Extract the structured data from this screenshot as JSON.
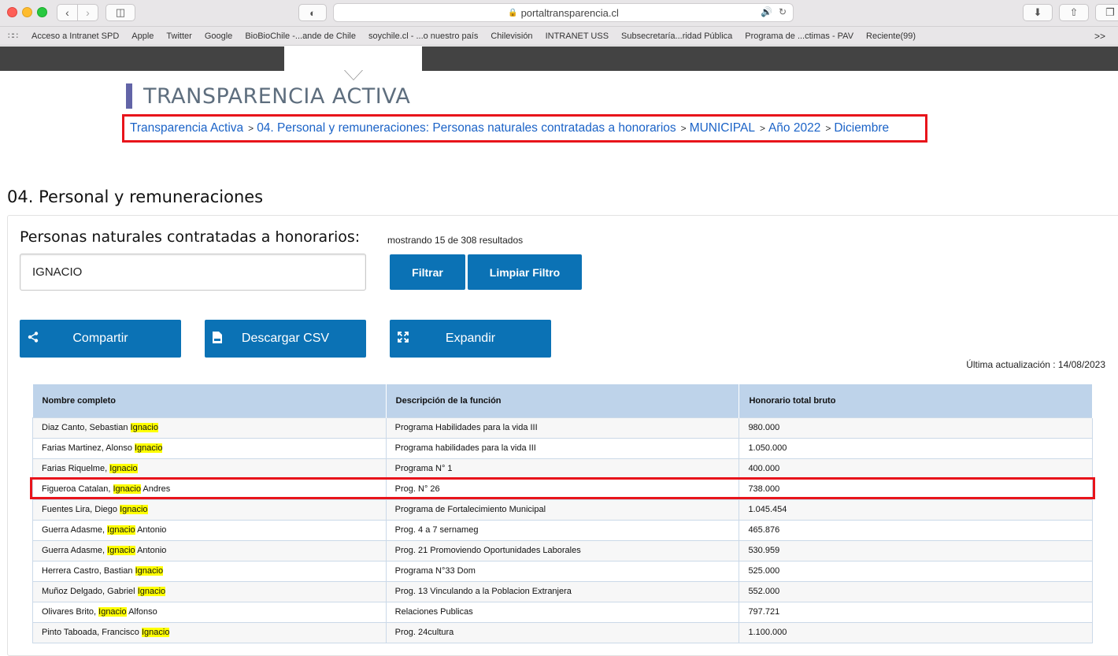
{
  "browser": {
    "url": "portaltransparencia.cl",
    "bookmarks": [
      "Acceso a Intranet SPD",
      "Apple",
      "Twitter",
      "Google",
      "BioBioChile -...ande de Chile",
      "soychile.cl - ...o nuestro país",
      "Chilevisión",
      "INTRANET USS",
      "Subsecretaría...ridad Pública",
      "Programa de ...ctimas - PAV",
      "Reciente(99)"
    ],
    "more": ">>"
  },
  "header": {
    "title": "TRANSPARENCIA ACTIVA",
    "breadcrumb": [
      "Transparencia Activa",
      "04. Personal y remuneraciones: Personas naturales contratadas a honorarios",
      "MUNICIPAL",
      "Año 2022",
      "Diciembre"
    ],
    "separator": ">"
  },
  "section": {
    "title": "04. Personal y remuneraciones"
  },
  "card": {
    "title": "Personas naturales contratadas a honorarios:",
    "results_count": "mostrando 15 de 308 resultados",
    "search_value": "IGNACIO",
    "filter_button": "Filtrar",
    "clear_button": "Limpiar Filtro",
    "share_button": "Compartir",
    "csv_button": "Descargar CSV",
    "expand_button": "Expandir",
    "last_updated": "Última actualización : 14/08/2023"
  },
  "table": {
    "columns": [
      "Nombre completo",
      "Descripción de la función",
      "Honorario total bruto"
    ],
    "highlight_term": "Ignacio",
    "rows": [
      {
        "pre": "Diaz Canto, Sebastian ",
        "match": "Ignacio",
        "post": "",
        "funcion": "Programa Habilidades para la vida III",
        "honorario": "980.000"
      },
      {
        "pre": "Farias Martinez, Alonso ",
        "match": "Ignacio",
        "post": "",
        "funcion": "Programa habilidades para la vida III",
        "honorario": "1.050.000"
      },
      {
        "pre": "Farias Riquelme, ",
        "match": "Ignacio",
        "post": "",
        "funcion": "Programa N° 1",
        "honorario": "400.000"
      },
      {
        "pre": "Figueroa Catalan, ",
        "match": "Ignacio",
        "post": " Andres",
        "funcion": "Prog. N° 26",
        "honorario": "738.000"
      },
      {
        "pre": "Fuentes Lira, Diego ",
        "match": "Ignacio",
        "post": "",
        "funcion": "Programa de Fortalecimiento Municipal",
        "honorario": "1.045.454"
      },
      {
        "pre": "Guerra Adasme, ",
        "match": "Ignacio",
        "post": " Antonio",
        "funcion": "Prog. 4 a 7 sernameg",
        "honorario": "465.876"
      },
      {
        "pre": "Guerra Adasme, ",
        "match": "Ignacio",
        "post": " Antonio",
        "funcion": "Prog. 21 Promoviendo Oportunidades Laborales",
        "honorario": "530.959"
      },
      {
        "pre": "Herrera Castro, Bastian ",
        "match": "Ignacio",
        "post": "",
        "funcion": "Programa N°33 Dom",
        "honorario": "525.000"
      },
      {
        "pre": "Muñoz Delgado, Gabriel ",
        "match": "Ignacio",
        "post": "",
        "funcion": "Prog. 13 Vinculando a la Poblacion Extranjera",
        "honorario": "552.000"
      },
      {
        "pre": "Olivares Brito, ",
        "match": "Ignacio",
        "post": " Alfonso",
        "funcion": "Relaciones Publicas",
        "honorario": "797.721"
      },
      {
        "pre": "Pinto Taboada, Francisco ",
        "match": "Ignacio",
        "post": "",
        "funcion": "Prog. 24cultura",
        "honorario": "1.100.000"
      }
    ]
  }
}
